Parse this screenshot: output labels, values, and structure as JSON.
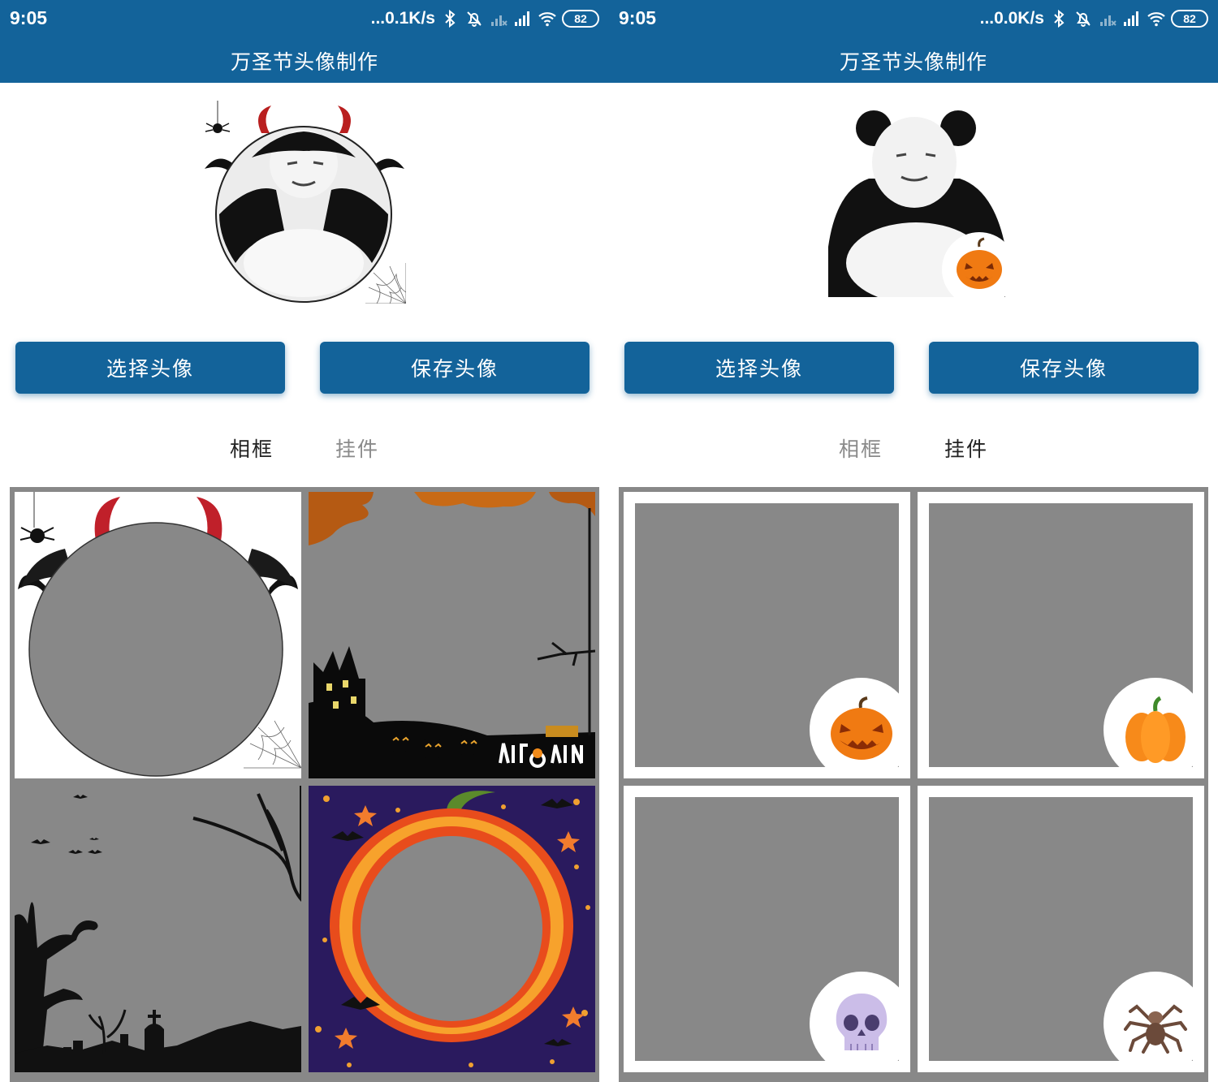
{
  "screens": [
    {
      "status": {
        "time": "9:05",
        "speed": "...0.1K/s",
        "battery": "82"
      },
      "title": "万圣节头像制作",
      "buttons": {
        "select": "选择头像",
        "save": "保存头像"
      },
      "tabs": [
        {
          "label": "相框",
          "active": true
        },
        {
          "label": "挂件",
          "active": false
        }
      ]
    },
    {
      "status": {
        "time": "9:05",
        "speed": "...0.0K/s",
        "battery": "82"
      },
      "title": "万圣节头像制作",
      "buttons": {
        "select": "选择头像",
        "save": "保存头像"
      },
      "tabs": [
        {
          "label": "相框",
          "active": false
        },
        {
          "label": "挂件",
          "active": true
        }
      ]
    }
  ],
  "frames": [
    "devil-bat-frame",
    "orange-halloween-frame",
    "graveyard-frame",
    "pumpkin-starry-frame"
  ],
  "pendants": [
    "jack-o-lantern-icon",
    "pumpkin-icon",
    "skull-icon",
    "spider-icon"
  ],
  "colors": {
    "primary": "#13639a",
    "placeholder": "#888888",
    "tab_active": "#222222",
    "tab_inactive": "#8a8a8a"
  }
}
